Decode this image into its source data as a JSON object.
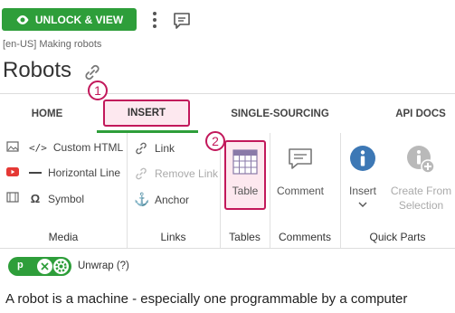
{
  "toolbar": {
    "unlock_label": "UNLOCK & VIEW",
    "accent": "#2e9e3a"
  },
  "breadcrumb": "[en-US] Making robots",
  "page_title": "Robots",
  "callouts": [
    "1",
    "2"
  ],
  "tabs": [
    {
      "label": "HOME"
    },
    {
      "label": "INSERT"
    },
    {
      "label": "SINGLE-SOURCING"
    },
    {
      "label": "API DOCS"
    }
  ],
  "ribbon": {
    "media": {
      "items": [
        {
          "label": "Custom HTML",
          "icon": "code-icon"
        },
        {
          "label": "Horizontal Line",
          "icon": "horizontal-line-icon"
        },
        {
          "label": "Symbol",
          "icon": "omega-icon"
        }
      ],
      "group_label": "Media"
    },
    "links": {
      "items": [
        {
          "label": "Link",
          "icon": "link-icon",
          "enabled": true
        },
        {
          "label": "Remove Link",
          "icon": "unlink-icon",
          "enabled": false
        },
        {
          "label": "Anchor",
          "icon": "anchor-icon",
          "enabled": true
        }
      ],
      "group_label": "Links"
    },
    "tables": {
      "button_label": "Table",
      "group_label": "Tables"
    },
    "comments": {
      "button_label": "Comment",
      "group_label": "Comments"
    },
    "quick_parts": {
      "insert_label": "Insert",
      "create_label_line1": "Create From",
      "create_label_line2": "Selection",
      "group_label": "Quick Parts"
    }
  },
  "status": {
    "tag": "p",
    "unwrap_label": "Unwrap (?)"
  },
  "body_text": "A robot is a machine - especially one programmable by a computer",
  "colors": {
    "highlight_border": "#c2185b",
    "highlight_fill": "#fde8ef"
  }
}
